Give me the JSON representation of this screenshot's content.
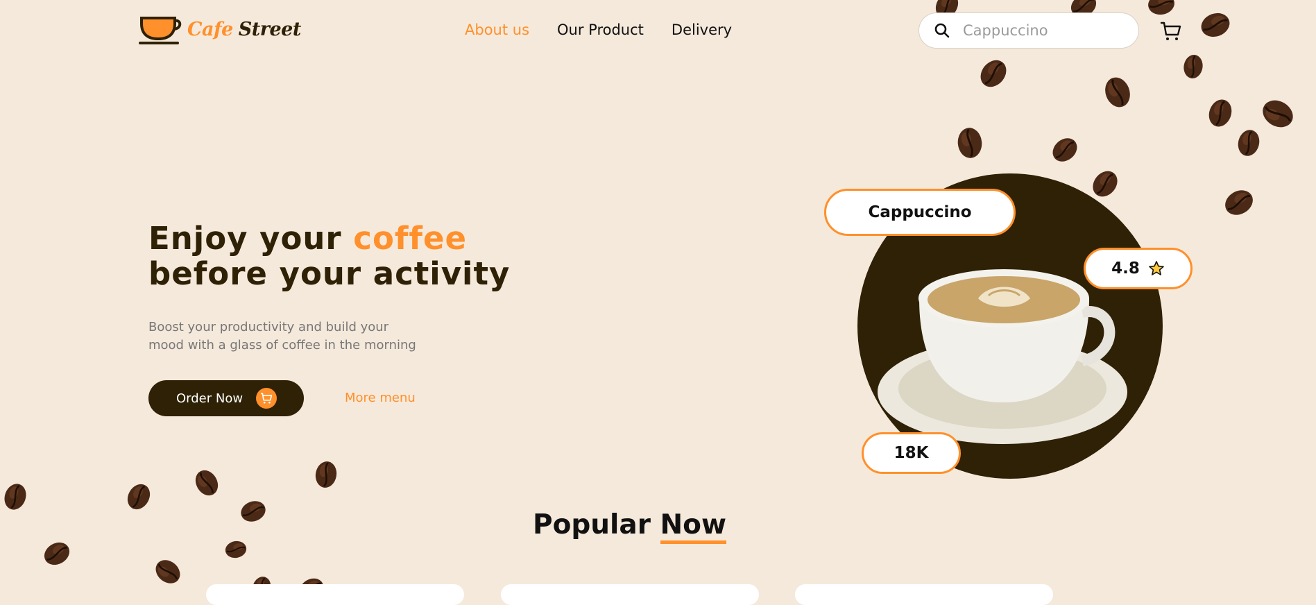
{
  "brand": {
    "name_part1": "Cafe",
    "name_part2": "Street"
  },
  "nav": {
    "items": [
      {
        "label": "About us",
        "active": true
      },
      {
        "label": "Our Product",
        "active": false
      },
      {
        "label": "Delivery",
        "active": false
      }
    ]
  },
  "search": {
    "placeholder": "Cappuccino",
    "icon": "search-icon"
  },
  "cart": {
    "icon": "cart-icon"
  },
  "hero": {
    "title_line1_plain": "Enjoy your ",
    "title_line1_accent": "coffee",
    "title_line2": "before your activity",
    "subtitle": "Boost your productivity and build your mood with a glass of coffee in the morning",
    "order_button": "Order Now",
    "more_link": "More menu"
  },
  "featured": {
    "name": "Cappuccino",
    "rating": "4.8",
    "count": "18K"
  },
  "popular": {
    "title_plain": "Popular ",
    "title_accent": "Now"
  },
  "colors": {
    "background": "#f5e9db",
    "accent": "#ff902b",
    "dark": "#2f2105"
  }
}
